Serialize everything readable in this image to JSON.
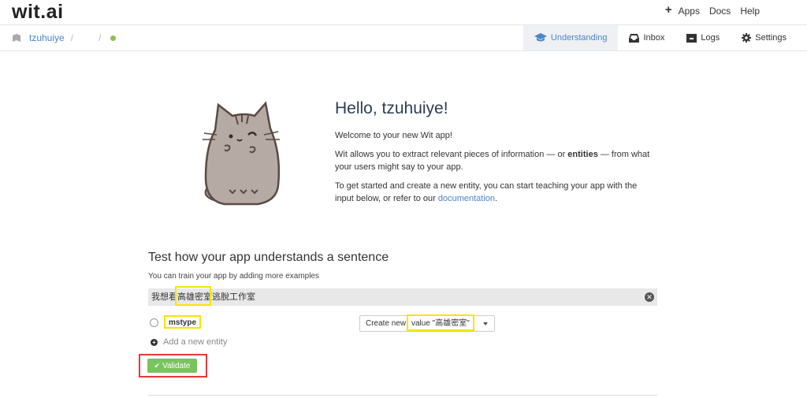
{
  "header": {
    "logo": "wit.ai",
    "nav": [
      "Apps",
      "Docs",
      "Help"
    ]
  },
  "subbar": {
    "username": "tzuhuiye",
    "sep1": "/",
    "sep2": "/",
    "tabs": [
      {
        "label": "Understanding",
        "icon": "graduation-cap-icon",
        "active": true
      },
      {
        "label": "Inbox",
        "icon": "inbox-icon",
        "active": false
      },
      {
        "label": "Logs",
        "icon": "logs-icon",
        "active": false
      },
      {
        "label": "Settings",
        "icon": "gear-icon",
        "active": false
      }
    ]
  },
  "hello": {
    "title": "Hello, tzuhuiye!",
    "welcome": "Welcome to your new Wit app!",
    "p2_a": "Wit allows you to extract relevant pieces of information — or ",
    "p2_bold": "entities",
    "p2_b": " — from what your users might say to your app.",
    "p3_a": "To get started and create a new entity, you can start teaching your app with the input below, or refer to our ",
    "p3_link": "documentation",
    "p3_b": "."
  },
  "test": {
    "title": "Test how your app understands a sentence",
    "subtitle": "You can train your app by adding more examples",
    "sentence": "我想看高雄密室逃脫工作室",
    "entity_name": "mstype",
    "create_label": "Create new",
    "create_value": "value \"高雄密室\"",
    "add_entity": "Add a new entity",
    "validate": "Validate"
  },
  "colors": {
    "accent": "#4a86c5",
    "validate": "#7ac35e",
    "highlight": "#f7e600",
    "outline": "#e53935",
    "status_dot": "#8bc34a"
  }
}
